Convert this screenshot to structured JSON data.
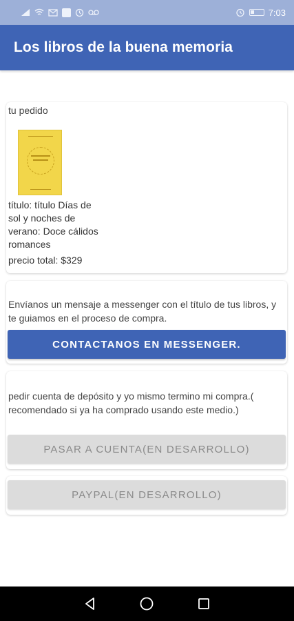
{
  "status_bar": {
    "time": "7:03",
    "left_icons": [
      "signal-icon",
      "wifi-icon",
      "mail-icon",
      "shield-icon",
      "sync-icon",
      "voicemail-icon"
    ],
    "right_icons": [
      "alarm-icon",
      "battery-icon"
    ]
  },
  "app_bar": {
    "title": "Los libros de la buena memoria",
    "color": "#3f64b5"
  },
  "order": {
    "label": "tu pedido",
    "book_title": "título: título Días de sol y noches de verano: Doce cálidos romances",
    "price": "precio total: $329"
  },
  "messenger": {
    "text": "Envíanos un mensaje a messenger con el título de tus libros, y te guiamos en el proceso de compra.",
    "button": "CONTACTANOS EN MESSENGER."
  },
  "deposit": {
    "text": "pedir cuenta de depósito y yo mismo termino mi compra.( recomendado si ya ha comprado usando este medio.)",
    "button": "PASAR A CUENTA(EN DESARROLLO)"
  },
  "paypal": {
    "button": "PAYPAL(EN DESARROLLO)"
  },
  "nav_bar": {
    "icons": [
      "back-icon",
      "home-icon",
      "recents-icon"
    ]
  }
}
